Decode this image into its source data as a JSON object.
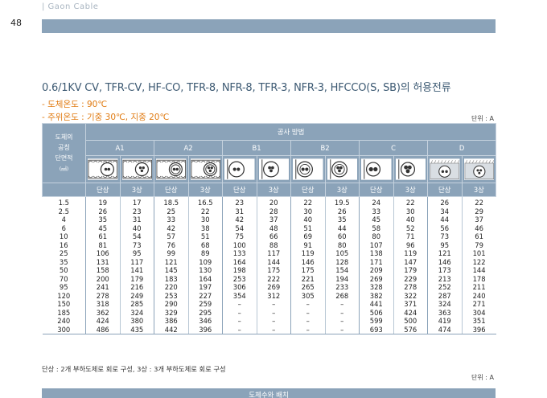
{
  "running_head": "| Gaon Cable",
  "page_number": "48",
  "title": "0.6/1KV CV, TFR-CV, HF-CO, TFR-8, NFR-8, TFR-3, NFR-3, HFCCO(S, SB)의 허용전류",
  "conditions": [
    "- 도체온도 : 90℃",
    "- 주위온도 : 기중 30℃, 지중 20℃"
  ],
  "unit_top": "단위 : A",
  "unit_bottom": "단위 : A",
  "table": {
    "size_header": {
      "line1": "도체의",
      "line2": "공칭",
      "line3": "단면적",
      "line4": "(㎟)"
    },
    "method_header": "공사 방법",
    "groups": [
      "A1",
      "A2",
      "B1",
      "B2",
      "C",
      "D"
    ],
    "phases": [
      "단상",
      "3상",
      "단상",
      "3상",
      "단상",
      "3상",
      "단상",
      "3상",
      "단상",
      "3상",
      "단상",
      "3상"
    ],
    "rows": [
      [
        "1.5",
        "19",
        "17",
        "18.5",
        "16.5",
        "23",
        "20",
        "22",
        "19.5",
        "24",
        "22",
        "26",
        "22"
      ],
      [
        "2.5",
        "26",
        "23",
        "25",
        "22",
        "31",
        "28",
        "30",
        "26",
        "33",
        "30",
        "34",
        "29"
      ],
      [
        "4",
        "35",
        "31",
        "33",
        "30",
        "42",
        "37",
        "40",
        "35",
        "45",
        "40",
        "44",
        "37"
      ],
      [
        "6",
        "45",
        "40",
        "42",
        "38",
        "54",
        "48",
        "51",
        "44",
        "58",
        "52",
        "56",
        "46"
      ],
      [
        "10",
        "61",
        "54",
        "57",
        "51",
        "75",
        "66",
        "69",
        "60",
        "80",
        "71",
        "73",
        "61"
      ],
      [
        "16",
        "81",
        "73",
        "76",
        "68",
        "100",
        "88",
        "91",
        "80",
        "107",
        "96",
        "95",
        "79"
      ],
      [
        "25",
        "106",
        "95",
        "99",
        "89",
        "133",
        "117",
        "119",
        "105",
        "138",
        "119",
        "121",
        "101"
      ],
      [
        "35",
        "131",
        "117",
        "121",
        "109",
        "164",
        "144",
        "146",
        "128",
        "171",
        "147",
        "146",
        "122"
      ],
      [
        "50",
        "158",
        "141",
        "145",
        "130",
        "198",
        "175",
        "175",
        "154",
        "209",
        "179",
        "173",
        "144"
      ],
      [
        "70",
        "200",
        "179",
        "183",
        "164",
        "253",
        "222",
        "221",
        "194",
        "269",
        "229",
        "213",
        "178"
      ],
      [
        "95",
        "241",
        "216",
        "220",
        "197",
        "306",
        "269",
        "265",
        "233",
        "328",
        "278",
        "252",
        "211"
      ],
      [
        "120",
        "278",
        "249",
        "253",
        "227",
        "354",
        "312",
        "305",
        "268",
        "382",
        "322",
        "287",
        "240"
      ],
      [
        "150",
        "318",
        "285",
        "290",
        "259",
        "–",
        "–",
        "–",
        "–",
        "441",
        "371",
        "324",
        "271"
      ],
      [
        "185",
        "362",
        "324",
        "329",
        "295",
        "–",
        "–",
        "–",
        "–",
        "506",
        "424",
        "363",
        "304"
      ],
      [
        "240",
        "424",
        "380",
        "386",
        "346",
        "–",
        "–",
        "–",
        "–",
        "599",
        "500",
        "419",
        "351"
      ],
      [
        "300",
        "486",
        "435",
        "442",
        "396",
        "–",
        "–",
        "–",
        "–",
        "693",
        "576",
        "474",
        "396"
      ]
    ]
  },
  "footnote": "단상 : 2개 부하도체로 회로 구성, 3상 : 3개 부하도체로 회로 구성",
  "bottom_band_label": "도체수와 배치",
  "icons": [
    "insulated-wall-two-cores-icon",
    "insulated-wall-three-cores-icon",
    "insulated-wall-cable-two-cores-icon",
    "insulated-wall-cable-three-cores-icon",
    "conduit-two-cores-icon",
    "conduit-three-cores-icon",
    "conduit-cable-two-cores-icon",
    "conduit-cable-three-cores-icon",
    "clipped-two-cores-icon",
    "clipped-three-cores-icon",
    "buried-duct-two-cores-icon",
    "buried-duct-three-cores-icon"
  ],
  "colors": {
    "accent": "#8ba3b9",
    "title": "#3d5a73",
    "condition": "#e07a10"
  }
}
